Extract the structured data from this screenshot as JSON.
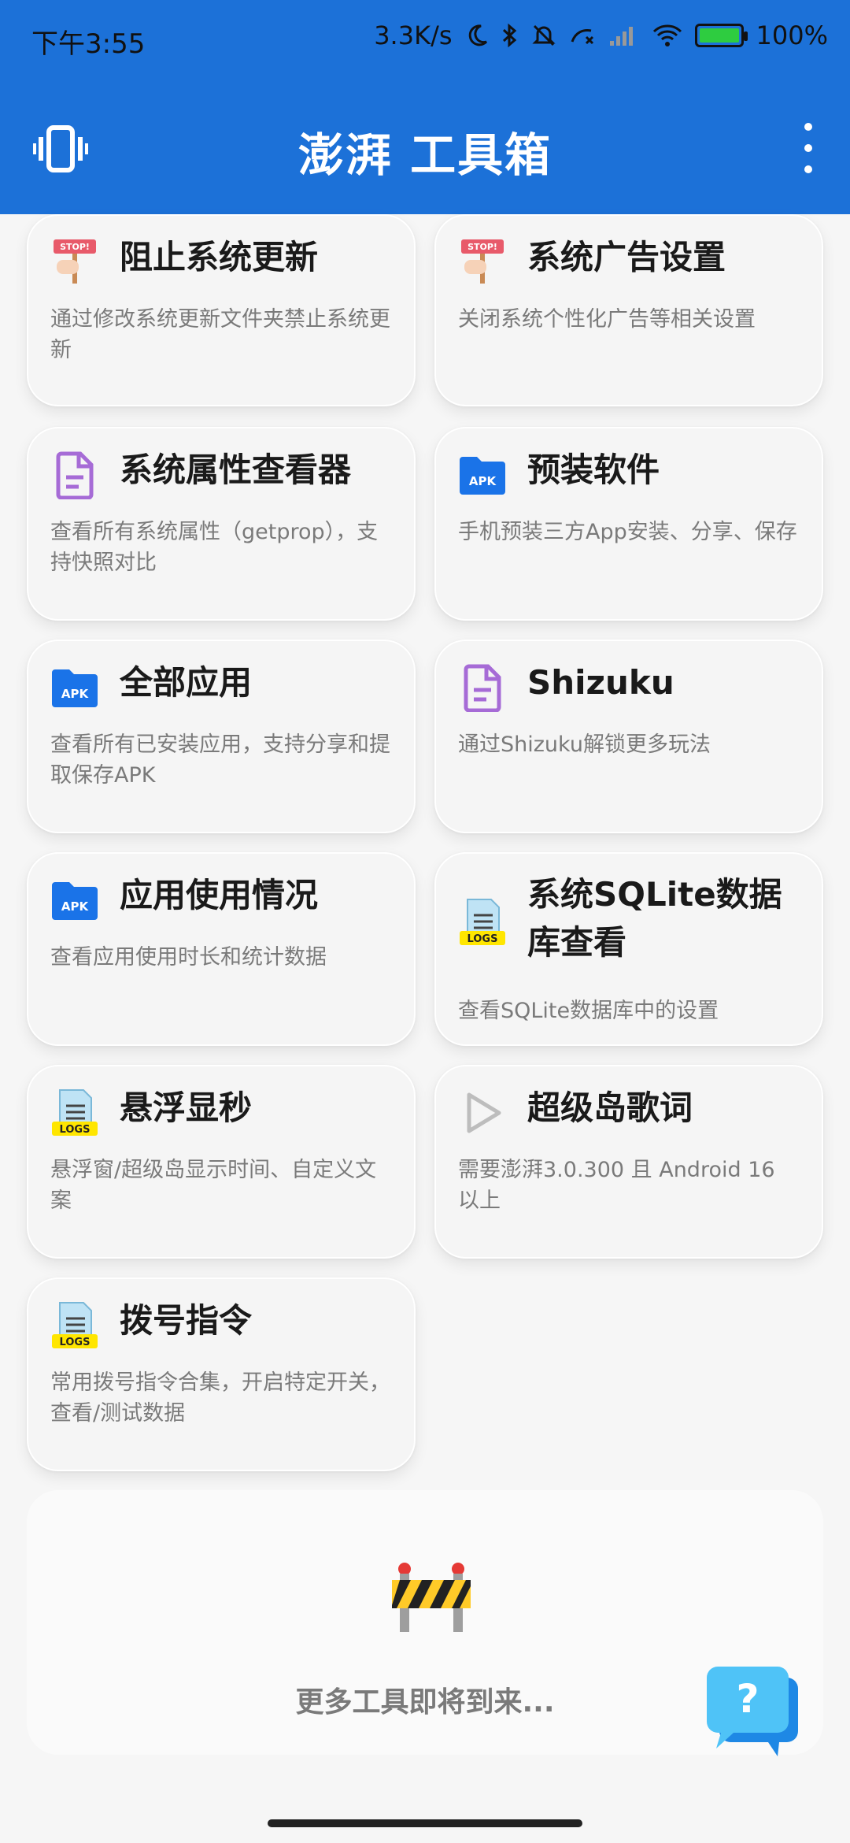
{
  "status": {
    "time": "下午3:55",
    "speed": "3.3K/s",
    "battery": "100%"
  },
  "appbar": {
    "title": "澎湃 工具箱"
  },
  "colors": {
    "primary": "#1c71d8",
    "apk_blue": "#1a73e8",
    "doc_purple": "#a66bd6",
    "logs_yellow": "#ffe600"
  },
  "cards": [
    {
      "title": "阻止系统更新",
      "desc": "通过修改系统更新文件夹禁止系统更新",
      "icon": "stop-sign-icon"
    },
    {
      "title": "系统广告设置",
      "desc": "关闭系统个性化广告等相关设置",
      "icon": "stop-sign-icon"
    },
    {
      "title": "系统属性查看器",
      "desc": "查看所有系统属性（getprop），支持快照对比",
      "icon": "document-icon"
    },
    {
      "title": "预装软件",
      "desc": "手机预装三方App安装、分享、保存",
      "icon": "apk-folder-icon"
    },
    {
      "title": "全部应用",
      "desc": "查看所有已安装应用，支持分享和提取保存APK",
      "icon": "apk-folder-icon"
    },
    {
      "title": "Shizuku",
      "desc": "通过Shizuku解锁更多玩法",
      "icon": "document-icon"
    },
    {
      "title": "应用使用情况",
      "desc": "查看应用使用时长和统计数据",
      "icon": "apk-folder-icon"
    },
    {
      "title": "系统SQLite数据库查看",
      "desc": "查看SQLite数据库中的设置",
      "icon": "logs-icon"
    },
    {
      "title": "悬浮显秒",
      "desc": "悬浮窗/超级岛显示时间、自定义文案",
      "icon": "logs-icon"
    },
    {
      "title": "超级岛歌词",
      "desc": "需要澎湃3.0.300 且 Android 16 以上",
      "icon": "play-icon"
    },
    {
      "title": "拨号指令",
      "desc": "常用拨号指令合集，开启特定开关，查看/测试数据",
      "icon": "logs-icon"
    }
  ],
  "icons": {
    "stop_label": "STOP!",
    "apk_label": "APK",
    "logs_label": "LOGS",
    "help_label": "?"
  },
  "coming_soon": {
    "text": "更多工具即将到来..."
  }
}
